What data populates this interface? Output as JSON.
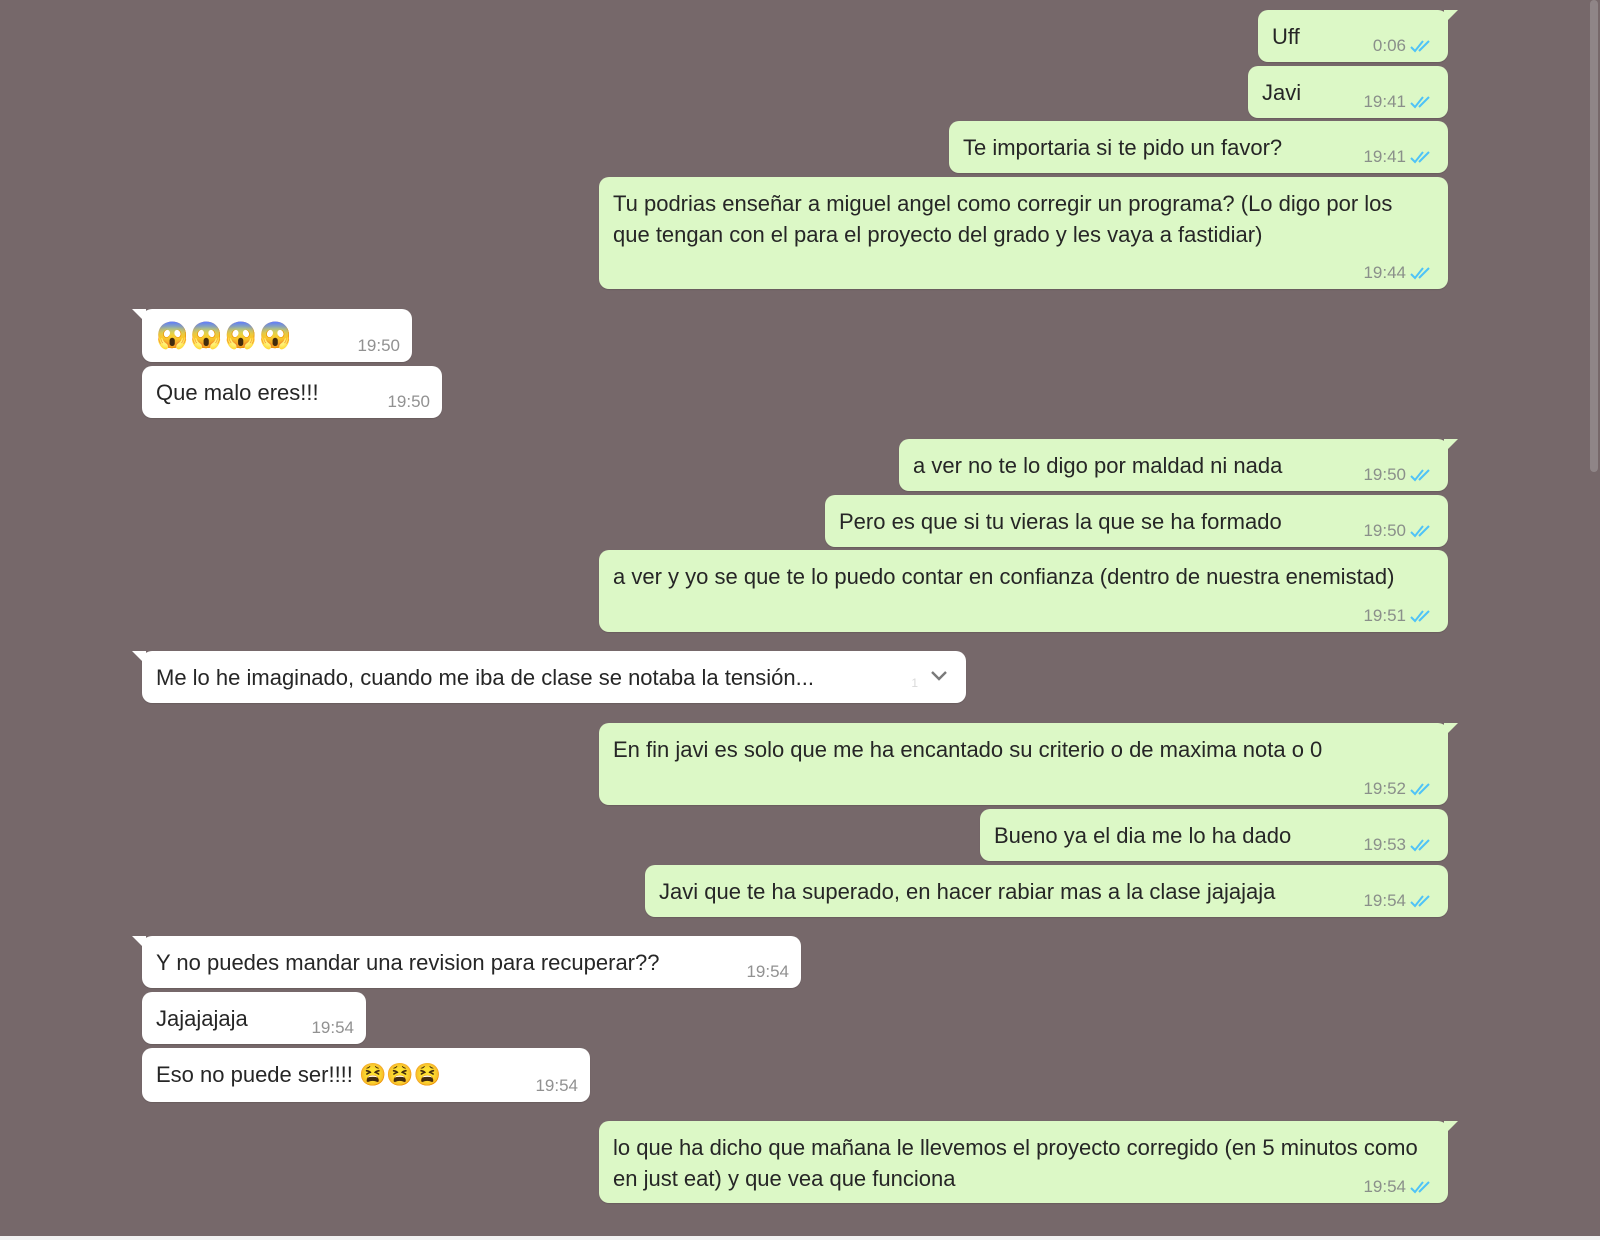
{
  "messages": [
    {
      "dir": "out",
      "text": "Uff",
      "time": "0:06"
    },
    {
      "dir": "out",
      "text": "Javi",
      "time": "19:41"
    },
    {
      "dir": "out",
      "text": "Te importaria si te pido un favor?",
      "time": "19:41"
    },
    {
      "dir": "out",
      "text": "Tu podrias enseñar a miguel angel como corregir un programa? (Lo digo por los que tengan con el para el proyecto del grado y les vaya a fastidiar)",
      "time": "19:44"
    },
    {
      "dir": "in",
      "text": "😱😱😱😱",
      "time": "19:50"
    },
    {
      "dir": "in",
      "text": "Que malo eres!!!",
      "time": "19:50"
    },
    {
      "dir": "out",
      "text": "a ver no te lo digo por maldad ni nada",
      "time": "19:50"
    },
    {
      "dir": "out",
      "text": "Pero es que si tu vieras la que se ha formado",
      "time": "19:50"
    },
    {
      "dir": "out",
      "text": "a ver y yo se que te lo puedo contar en confianza (dentro de nuestra enemistad)",
      "time": "19:51"
    },
    {
      "dir": "in",
      "text": "Me lo he imaginado, cuando me iba de clase se notaba la tensión...",
      "time": "",
      "faint": "1"
    },
    {
      "dir": "out",
      "text": "En fin javi es solo que me ha encantado su criterio o de maxima nota o 0",
      "time": "19:52"
    },
    {
      "dir": "out",
      "text": "Bueno ya el dia me lo ha dado",
      "time": "19:53"
    },
    {
      "dir": "out",
      "text": "Javi que te ha superado, en hacer rabiar mas a la clase jajajaja",
      "time": "19:54"
    },
    {
      "dir": "in",
      "text": "Y no puedes mandar una revision para recuperar??",
      "time": "19:54"
    },
    {
      "dir": "in",
      "text": "Jajajajaja",
      "time": "19:54"
    },
    {
      "dir": "in",
      "text": "Eso no puede ser!!!! 😫😫😫",
      "time": "19:54"
    },
    {
      "dir": "out",
      "text": "lo que ha dicho que mañana le llevemos el proyecto corregido (en 5 minutos como en just eat) y que vea que funciona",
      "time": "19:54"
    }
  ],
  "colors": {
    "background": "#76686a",
    "outgoing_bubble": "#dcf8c6",
    "incoming_bubble": "#ffffff",
    "read_ticks": "#4fc3f7"
  },
  "icons": {
    "read_receipt": "double-check-icon",
    "menu": "chevron-down-icon"
  }
}
